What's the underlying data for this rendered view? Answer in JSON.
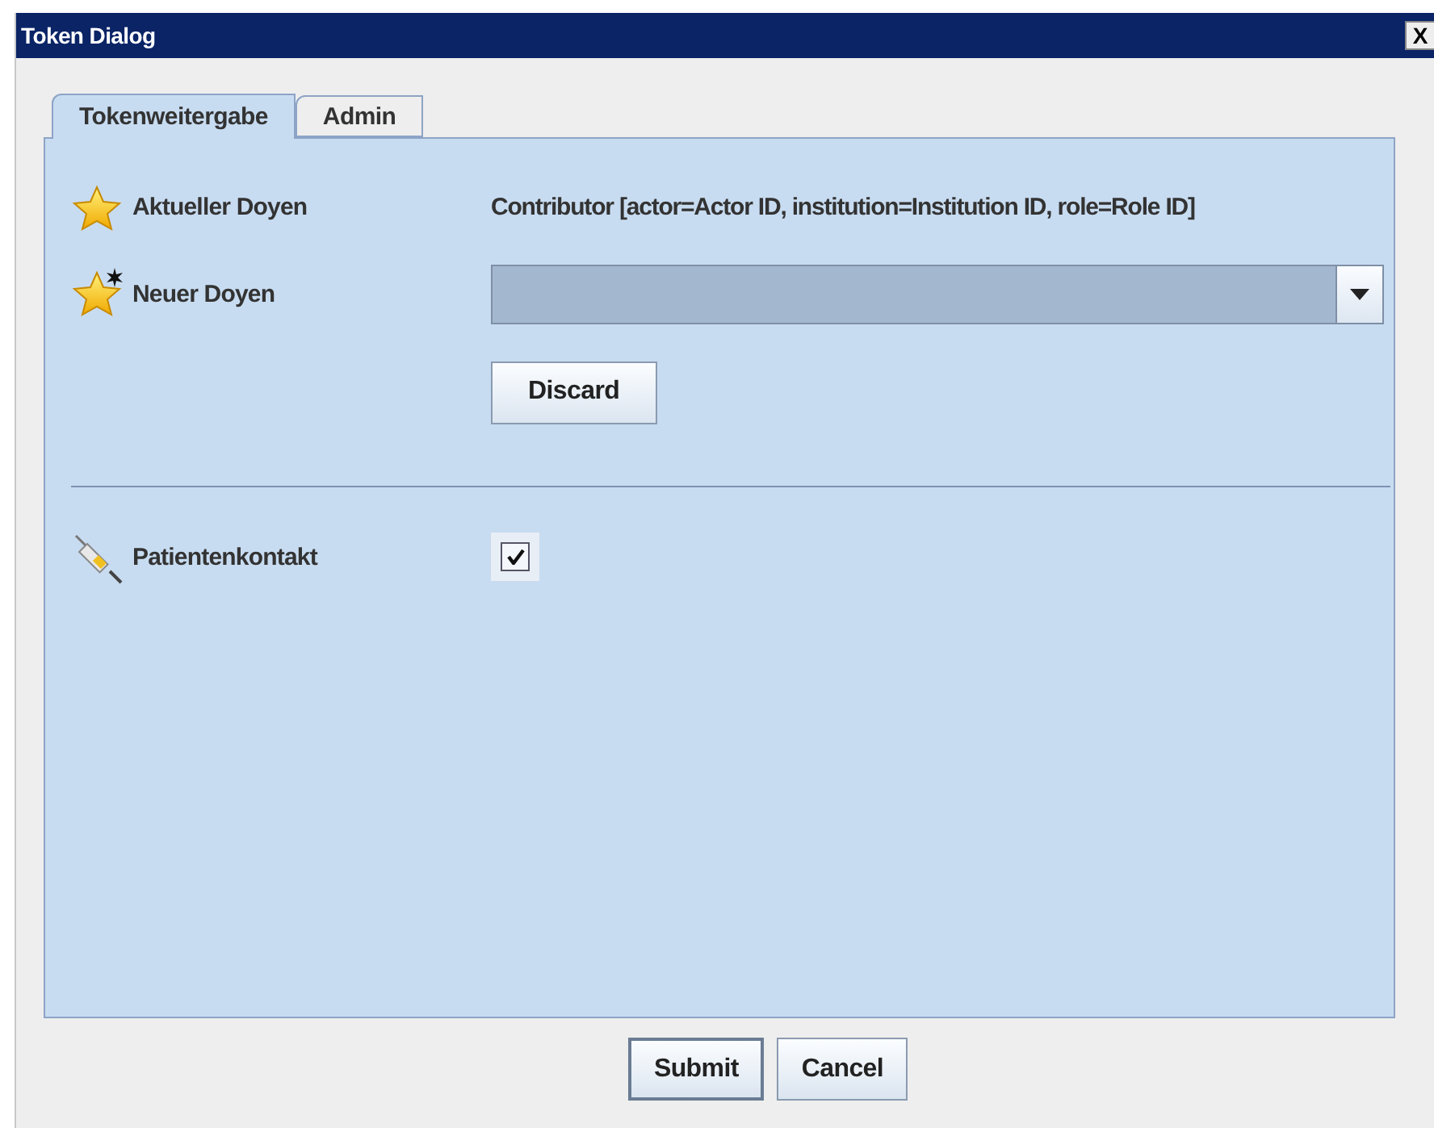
{
  "window": {
    "title": "Token Dialog",
    "close": "X"
  },
  "tabs": [
    {
      "label": "Tokenweitergabe",
      "selected": true
    },
    {
      "label": "Admin",
      "selected": false
    }
  ],
  "form": {
    "current": {
      "label": "Aktueller Doyen",
      "value": "Contributor [actor=Actor ID, institution=Institution ID, role=Role ID]"
    },
    "new": {
      "label": "Neuer Doyen"
    },
    "discard": "Discard",
    "contact": {
      "label": "Patientenkontakt",
      "checked": true
    }
  },
  "buttons": [
    "Submit",
    "Cancel"
  ]
}
